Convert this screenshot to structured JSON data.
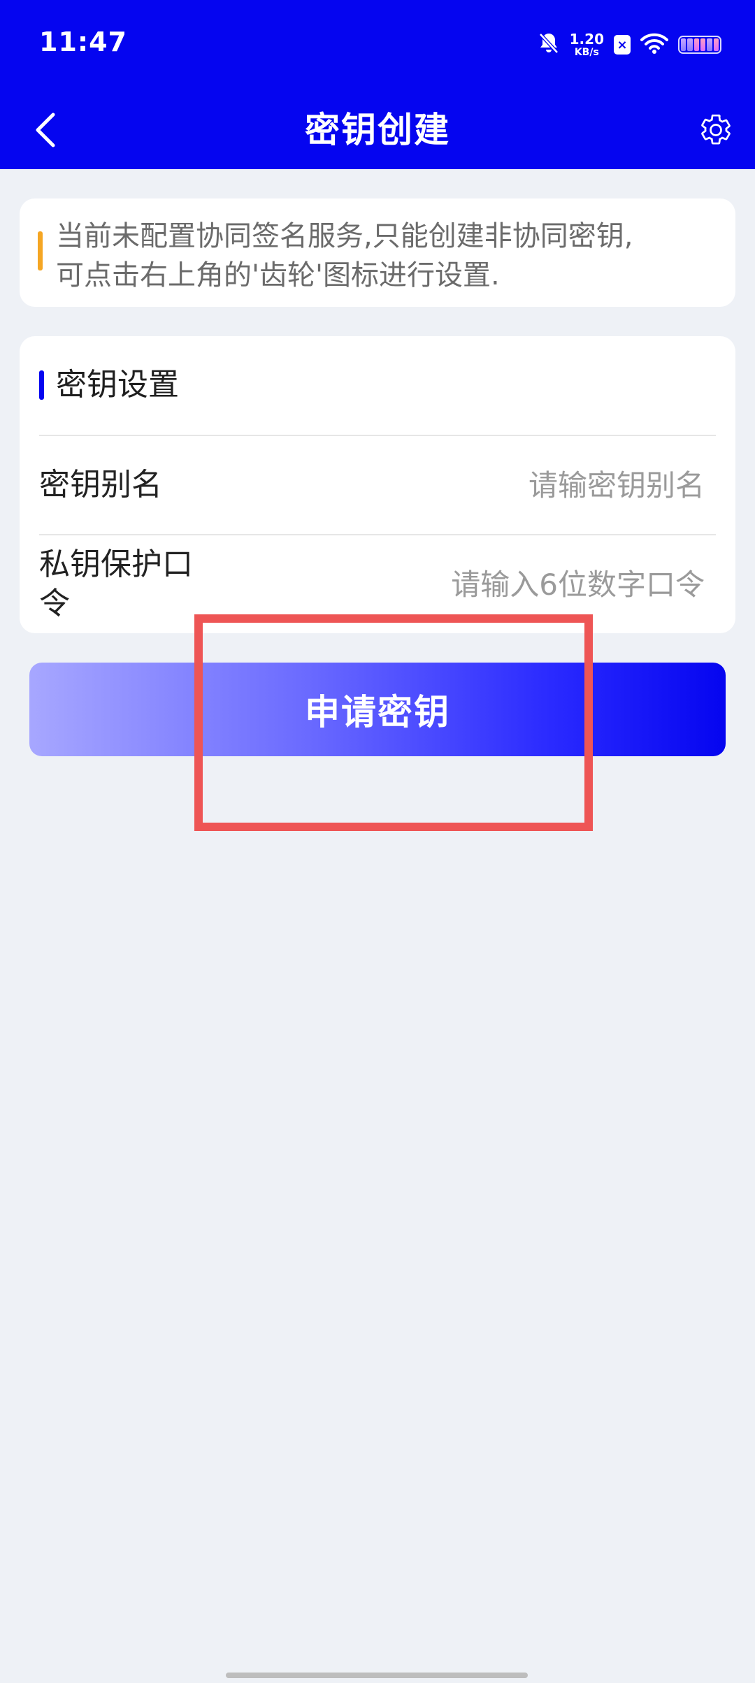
{
  "status_bar": {
    "time": "11:47",
    "net_speed_value": "1.20",
    "net_speed_unit": "KB/s",
    "sim_badge": "×",
    "icons": [
      "bell-mute-icon",
      "sim-icon",
      "wifi-icon",
      "battery-icon"
    ]
  },
  "app_bar": {
    "title": "密钥创建",
    "back_icon": "chevron-left-icon",
    "settings_icon": "gear-icon"
  },
  "notice": {
    "text": "当前未配置协同签名服务,只能创建非协同密钥,\n可点击右上角的'齿轮'图标进行设置."
  },
  "key_settings": {
    "section_title": "密钥设置",
    "fields": [
      {
        "label": "密钥别名",
        "value": "",
        "placeholder": "请输密钥别名"
      },
      {
        "label": "私钥保护口\n令",
        "value": "",
        "placeholder": "请输入6位数字口令"
      }
    ]
  },
  "actions": {
    "apply_label": "申请密钥"
  },
  "colors": {
    "primary": "#0505f0",
    "notice_accent": "#f5a623",
    "highlight": "#ee5555",
    "background": "#eef1f6"
  }
}
